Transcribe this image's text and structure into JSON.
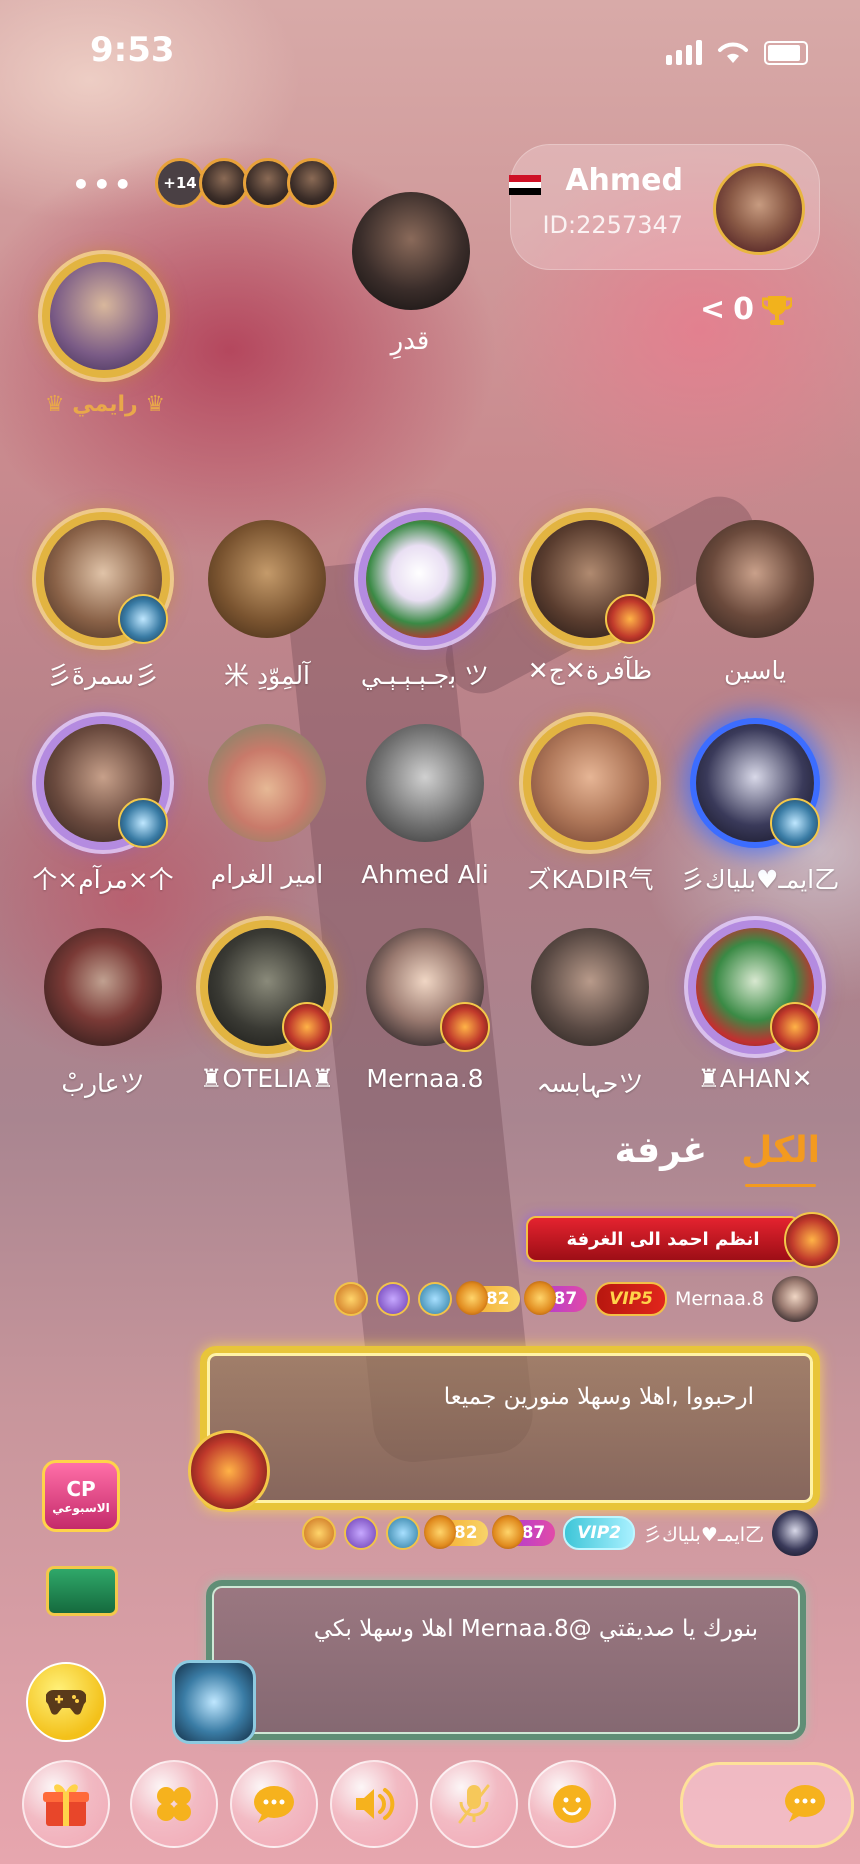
{
  "status_bar": {
    "time": "9:53"
  },
  "header": {
    "more_label": "•••",
    "viewer_count": "+14",
    "owner": {
      "name": "Ahmed",
      "id": "ID:2257347"
    },
    "score": "0",
    "score_chevron": "<"
  },
  "host": {
    "name": "قدرِ"
  },
  "featured_seat": {
    "name": "♛ رايمي ♛"
  },
  "seats": [
    {
      "name": "ياسين"
    },
    {
      "name": "✕ظآفرة✕ج"
    },
    {
      "name": "ﺑجـﯧـﯧـﯧـي ツ"
    },
    {
      "name": "米 آلمِوّدِ"
    },
    {
      "name": "彡سمرةَ彡"
    },
    {
      "name": "彡ايمـ♥بلياك乙"
    },
    {
      "name": "ズKADIR气"
    },
    {
      "name": "Ahmed Ali"
    },
    {
      "name": "امير الغرام"
    },
    {
      "name": "个×مرآم×个"
    },
    {
      "name": "♜AHAN✕"
    },
    {
      "name": "حہابسہツ"
    },
    {
      "name": "Mernaa.8"
    },
    {
      "name": "♜OTELIA♜"
    },
    {
      "name": "عاربْツ"
    }
  ],
  "tabs": [
    {
      "label": "الكل"
    },
    {
      "label": "غرفة"
    }
  ],
  "chat": {
    "join_banner": "انظم احمد الى الغرفة",
    "messages": [
      {
        "user": "Mernaa.8",
        "level1": "82",
        "level2": "87",
        "vip": "VIP5",
        "text": "ارحبووا ,اهلا وسهلا منورين جميعا"
      },
      {
        "user": "彡ايمـ♥بلياك乙",
        "level1": "82",
        "level2": "87",
        "vip": "VIP2",
        "text": "بنورك يا صديقتي @Mernaa.8 اهلا وسهلا بكي"
      }
    ]
  },
  "side": {
    "cp_label": "CP",
    "cp_sub": "الاسبوعي"
  },
  "colors": {
    "accent": "#f39a1f",
    "gold": "#e2b441",
    "tab_inactive": "#ffffff"
  }
}
